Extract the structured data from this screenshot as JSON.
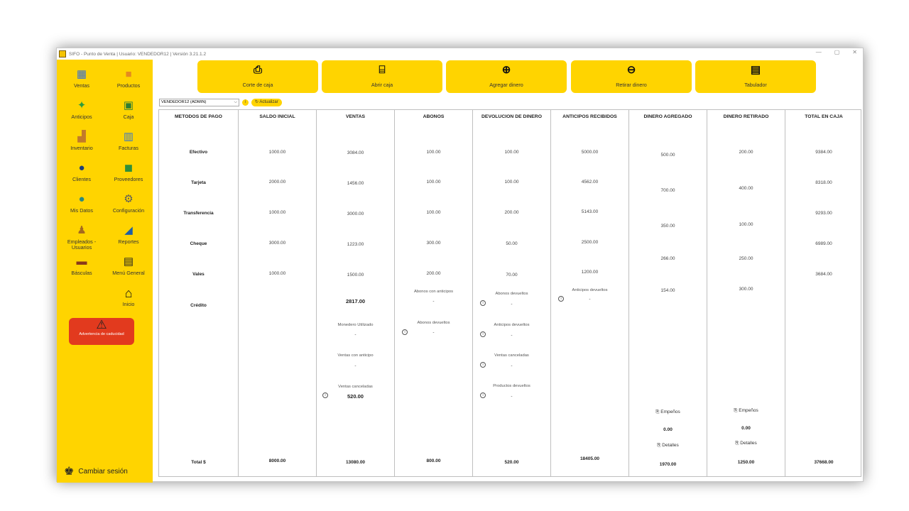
{
  "window": {
    "title": "SIFO - Punto de Venta  |  Usuario: VENDEDOR12 | Versión 3.21.1.2",
    "controls": [
      "—",
      "▢",
      "✕"
    ]
  },
  "sidebar": {
    "items": [
      {
        "label": "Ventas",
        "icon": "register-icon"
      },
      {
        "label": "Productos",
        "icon": "box-icon"
      },
      {
        "label": "Anticipos",
        "icon": "money-icon"
      },
      {
        "label": "Caja",
        "icon": "cash-icon"
      },
      {
        "label": "Inventario",
        "icon": "boxes-icon"
      },
      {
        "label": "Facturas",
        "icon": "invoice-icon"
      },
      {
        "label": "Clientes",
        "icon": "person-icon"
      },
      {
        "label": "Proveedores",
        "icon": "truck-icon"
      },
      {
        "label": "Mis Datos",
        "icon": "user-icon"
      },
      {
        "label": "Configuración",
        "icon": "gear-icon"
      },
      {
        "label": "Empleados - Usuarios",
        "icon": "group-icon"
      },
      {
        "label": "Reportes",
        "icon": "chart-icon"
      },
      {
        "label": "Básculas",
        "icon": "scale-icon"
      },
      {
        "label": "Menú General",
        "icon": "clipboard-icon"
      },
      {
        "label": "Inicio",
        "icon": "home-icon"
      }
    ],
    "warning_label": "Advertencia de caducidad",
    "switch_session": "Cambiar sesión"
  },
  "toolbar": {
    "buttons": [
      {
        "label": "Corte de caja",
        "icon": "cash-cut-icon",
        "glyph": "⎙"
      },
      {
        "label": "Abrir caja",
        "icon": "open-register-icon",
        "glyph": "⌸"
      },
      {
        "label": "Agregar dinero",
        "icon": "plus-circle-icon",
        "glyph": "⊕"
      },
      {
        "label": "Retirar dinero",
        "icon": "minus-circle-icon",
        "glyph": "⊖"
      },
      {
        "label": "Tabulador",
        "icon": "tabulator-icon",
        "glyph": "▤"
      }
    ]
  },
  "user_select": {
    "value": "VENDEDOR12 (ADMIN)",
    "info": "i",
    "refresh_label": "Actualizar"
  },
  "table": {
    "headers": {
      "metodos": "METODOS DE PAGO",
      "saldo": "SALDO INICIAL",
      "ventas": "VENTAS",
      "abonos": "ABONOS",
      "devolucion": "DEVOLUCION DE DINERO",
      "anticipos": "ANTICIPOS RECIBIDOS",
      "agregado": "DINERO AGREGADO",
      "retirado": "DINERO RETIRADO",
      "total": "TOTAL EN CAJA"
    },
    "methods": [
      "Efectivo",
      "Tarjeta",
      "Transferencia",
      "Cheque",
      "Vales",
      "Crédito"
    ],
    "saldo": [
      "1000.00",
      "2000.00",
      "1000.00",
      "3000.00",
      "1000.00"
    ],
    "ventas": [
      "3084.00",
      "1456.00",
      "3000.00",
      "1223.00",
      "1500.00",
      "2817.00"
    ],
    "abonos": [
      "100.00",
      "100.00",
      "100.00",
      "300.00",
      "200.00"
    ],
    "devolucion": [
      "100.00",
      "100.00",
      "200.00",
      "50.00",
      "70.00"
    ],
    "anticipos": [
      "5000.00",
      "4562.00",
      "5143.00",
      "2500.00",
      "1200.00"
    ],
    "agregado": [
      "500.00",
      "700.00",
      "350.00",
      "266.00",
      "154.00"
    ],
    "retirado": [
      "200.00",
      "400.00",
      "100.00",
      "250.00",
      "300.00"
    ],
    "total": [
      "9384.00",
      "8318.00",
      "9293.00",
      "6989.00",
      "3684.00"
    ],
    "ventas_sub": {
      "monedero_label": "Monedero Utilizado",
      "monedero_value": "-",
      "anticipo_label": "Ventas con anticipo",
      "anticipo_value": "-",
      "canceladas_label": "Ventas canceladas",
      "canceladas_value": "520.00"
    },
    "abonos_sub": {
      "anticipos_label": "Abonos con anticipos",
      "anticipos_value": "-",
      "devueltos_label": "Abonos devueltos",
      "devueltos_value": "-"
    },
    "devolucion_sub": {
      "abonos_label": "Abonos devueltos",
      "abonos_value": "-",
      "anticipos_label": "Anticipos devueltos",
      "anticipos_value": "-",
      "canceladas_label": "Ventas canceladas",
      "canceladas_value": "-",
      "productos_label": "Productos devueltos",
      "productos_value": "-"
    },
    "anticipos_sub": {
      "label": "Anticipos devueltos",
      "value": "-"
    },
    "agregado_extra": {
      "empenos_label": "Empeños",
      "empenos_value": "0.00",
      "detalles_label": "Detalles"
    },
    "retirado_extra": {
      "empenos_label": "Empeños",
      "empenos_value": "0.00",
      "detalles_label": "Detalles"
    },
    "totals": {
      "label": "Total $",
      "saldo": "8000.00",
      "ventas": "13080.00",
      "abonos": "800.00",
      "devolucion": "520.00",
      "anticipos": "18405.00",
      "agregado": "1970.00",
      "retirado": "1250.00",
      "total": "37668.00"
    }
  },
  "colors": {
    "accent": "#ffd400",
    "warning": "#e23a1e"
  }
}
